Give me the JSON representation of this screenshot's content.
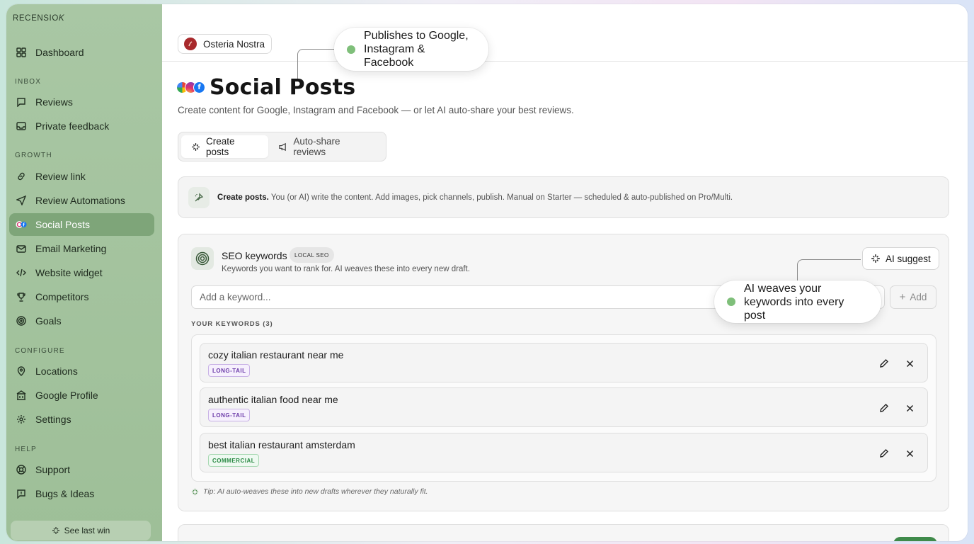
{
  "brand": "RECENSIO",
  "sidebar": {
    "items": [
      {
        "label": "Dashboard",
        "icon": "grid-icon"
      },
      {
        "label": "Reviews",
        "icon": "message-icon"
      },
      {
        "label": "Private feedback",
        "icon": "inbox-icon"
      },
      {
        "label": "Review link",
        "icon": "link-icon"
      },
      {
        "label": "Review Automations",
        "icon": "send-icon"
      },
      {
        "label": "Social Posts",
        "icon": "social-icon"
      },
      {
        "label": "Email Marketing",
        "icon": "mail-icon"
      },
      {
        "label": "Website widget",
        "icon": "code-icon"
      },
      {
        "label": "Competitors",
        "icon": "trophy-icon"
      },
      {
        "label": "Goals",
        "icon": "target-icon"
      },
      {
        "label": "Locations",
        "icon": "pin-icon"
      },
      {
        "label": "Google Profile",
        "icon": "building-icon"
      },
      {
        "label": "Settings",
        "icon": "gear-icon"
      },
      {
        "label": "Support",
        "icon": "lifebuoy-icon"
      },
      {
        "label": "Bugs & Ideas",
        "icon": "bug-icon"
      }
    ],
    "sections": {
      "inbox": "INBOX",
      "growth": "GROWTH",
      "configure": "CONFIGURE",
      "help": "HELP"
    },
    "last_win": "See last win"
  },
  "location": {
    "name": "Osteria Nostra"
  },
  "callouts": {
    "publish": "Publishes to Google, Instagram & Facebook",
    "keywords": "AI weaves your keywords into every post"
  },
  "page": {
    "title": "Social Posts",
    "subtitle": "Create content for Google, Instagram and Facebook — or let AI auto-share your best reviews."
  },
  "tabs": [
    {
      "label": "Create posts",
      "icon": "sparkle-icon"
    },
    {
      "label": "Auto-share reviews",
      "icon": "megaphone-icon"
    }
  ],
  "info": {
    "title": "Create posts.",
    "text": "You (or AI) write the content. Add images, pick channels, publish. Manual on Starter — scheduled & auto-published on Pro/Multi."
  },
  "seo": {
    "title": "SEO keywords",
    "badge": "LOCAL SEO",
    "description": "Keywords you want to rank for. AI weaves these into every new draft.",
    "ai_suggest": "AI suggest",
    "input_placeholder": "Add a keyword...",
    "add_label": "Add",
    "list_header": "YOUR KEYWORDS (3)",
    "keywords": [
      {
        "text": "cozy italian restaurant near me",
        "tag": "LONG-TAIL"
      },
      {
        "text": "authentic italian food near me",
        "tag": "LONG-TAIL"
      },
      {
        "text": "best italian restaurant amsterdam",
        "tag": "COMMERCIAL"
      }
    ],
    "tip": "Tip: AI auto-weaves these into new drafts wherever they naturally fit."
  },
  "colors": {
    "sidebar_bg": "#a9c7a4",
    "active_item": "#7ea579",
    "callout_dot": "#7fbf7a",
    "tag_long_tail": "#6b3aa8",
    "tag_commercial": "#2b8a45"
  }
}
